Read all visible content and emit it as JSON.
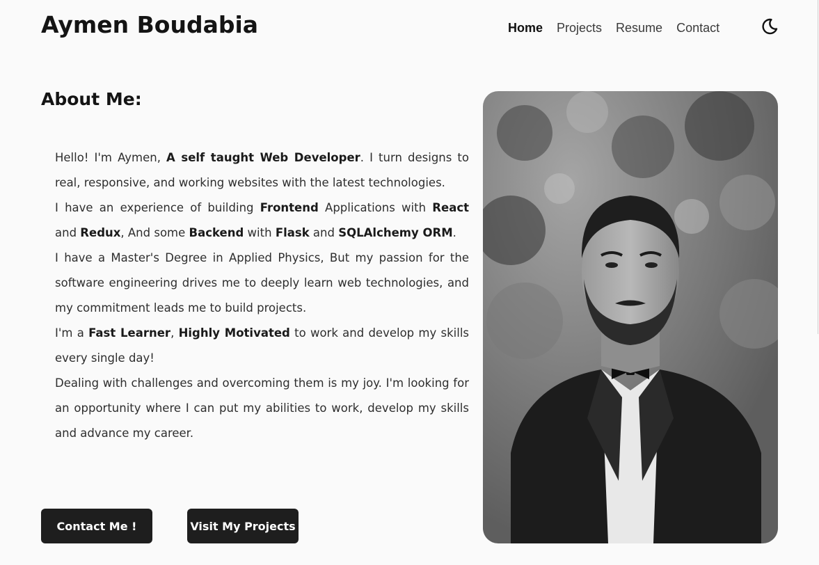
{
  "header": {
    "site_title": "Aymen Boudabia",
    "nav": [
      {
        "label": "Home",
        "active": true
      },
      {
        "label": "Projects",
        "active": false
      },
      {
        "label": "Resume",
        "active": false
      },
      {
        "label": "Contact",
        "active": false
      }
    ],
    "theme_toggle_icon": "moon-icon"
  },
  "about": {
    "heading": "About Me:",
    "paragraphs": [
      {
        "segments": [
          {
            "text": " Hello! I'm Aymen, ",
            "bold": false
          },
          {
            "text": "A self taught Web Developer",
            "bold": true
          },
          {
            "text": ". I turn designs to real, responsive, and working websites with the latest technologies.",
            "bold": false
          }
        ]
      },
      {
        "segments": [
          {
            "text": "I have an experience of building ",
            "bold": false
          },
          {
            "text": "Frontend",
            "bold": true
          },
          {
            "text": " Applications with ",
            "bold": false
          },
          {
            "text": "React",
            "bold": true
          },
          {
            "text": " and ",
            "bold": false
          },
          {
            "text": "Redux",
            "bold": true
          },
          {
            "text": ", And some ",
            "bold": false
          },
          {
            "text": "Backend",
            "bold": true
          },
          {
            "text": " with ",
            "bold": false
          },
          {
            "text": "Flask",
            "bold": true
          },
          {
            "text": " and ",
            "bold": false
          },
          {
            "text": "SQLAlchemy ORM",
            "bold": true
          },
          {
            "text": ".",
            "bold": false
          }
        ]
      },
      {
        "segments": [
          {
            "text": "I have a Master's Degree in Applied Physics, But my passion for the software engineering drives me to deeply learn web technologies, and my commitment leads me to build projects.",
            "bold": false
          }
        ]
      },
      {
        "segments": [
          {
            "text": "I'm a ",
            "bold": false
          },
          {
            "text": "Fast Learner",
            "bold": true
          },
          {
            "text": ", ",
            "bold": false
          },
          {
            "text": "Highly Motivated",
            "bold": true
          },
          {
            "text": " to work and develop my skills every single day!",
            "bold": false
          }
        ]
      },
      {
        "segments": [
          {
            "text": "Dealing with challenges and overcoming them is my joy. I'm looking for an opportunity where I can put my abilities to work, develop my skills and advance my career.",
            "bold": false
          }
        ]
      }
    ]
  },
  "buttons": {
    "contact_label": "Contact Me !",
    "projects_label": "Visit My Projects"
  },
  "colors": {
    "background": "#fafafa",
    "text": "#1c1c1c",
    "button_bg": "#1e1e1e",
    "button_text": "#ffffff"
  }
}
